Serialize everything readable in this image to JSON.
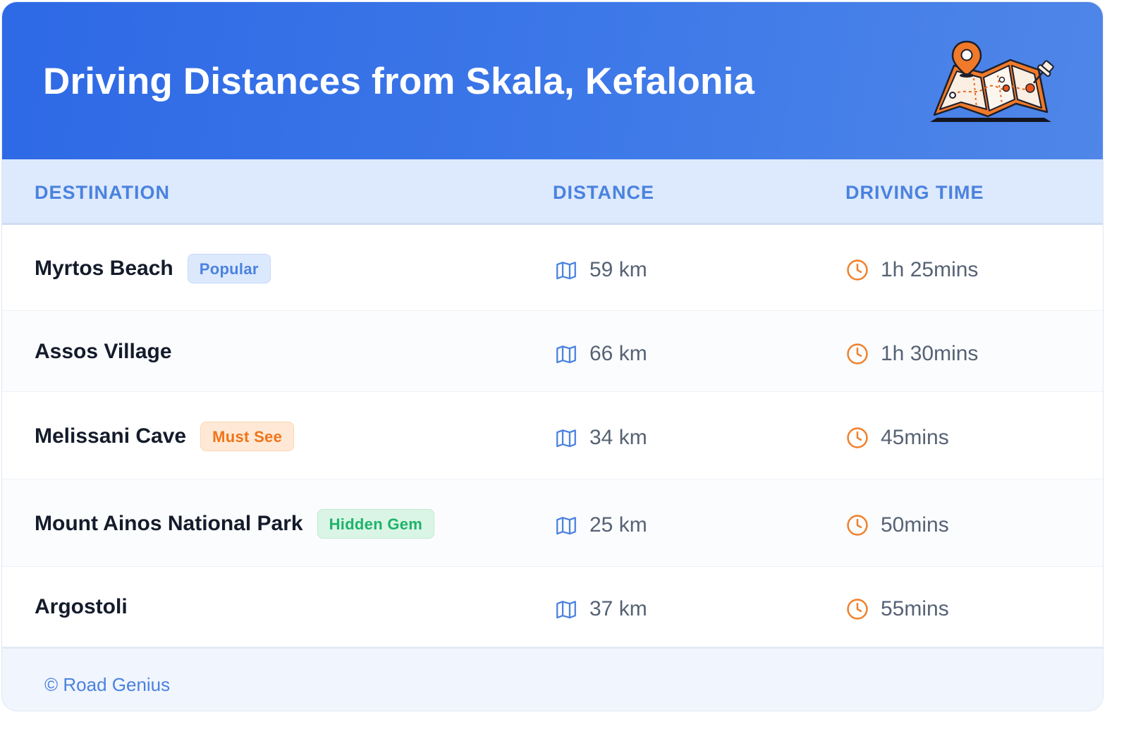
{
  "header": {
    "title": "Driving Distances from Skala, Kefalonia",
    "illustration_icon": "folded-map-with-pin-icon",
    "gradient_start": "#2e69e6",
    "gradient_end": "#4f86e8"
  },
  "table": {
    "columns": {
      "destination": "DESTINATION",
      "distance": "DISTANCE",
      "driving_time": "DRIVING TIME"
    },
    "distance_icon": "map-icon",
    "time_icon": "clock-icon",
    "rows": [
      {
        "destination": "Myrtos Beach",
        "badge": "Popular",
        "badge_color": "blue",
        "distance": "59 km",
        "time": "1h 25mins"
      },
      {
        "destination": "Assos Village",
        "badge": "",
        "badge_color": "",
        "distance": "66 km",
        "time": "1h 30mins"
      },
      {
        "destination": "Melissani Cave",
        "badge": "Must See",
        "badge_color": "orange",
        "distance": "34 km",
        "time": "45mins"
      },
      {
        "destination": "Mount Ainos National Park",
        "badge": "Hidden Gem",
        "badge_color": "green",
        "distance": "25 km",
        "time": "50mins"
      },
      {
        "destination": "Argostoli",
        "badge": "",
        "badge_color": "",
        "distance": "37 km",
        "time": "55mins"
      }
    ]
  },
  "footer": {
    "copyright": "© Road Genius"
  },
  "colors": {
    "accent_blue": "#4a82df",
    "accent_orange": "#f0741a",
    "accent_green": "#1eb36a",
    "header_row_bg": "#dde9fc"
  }
}
